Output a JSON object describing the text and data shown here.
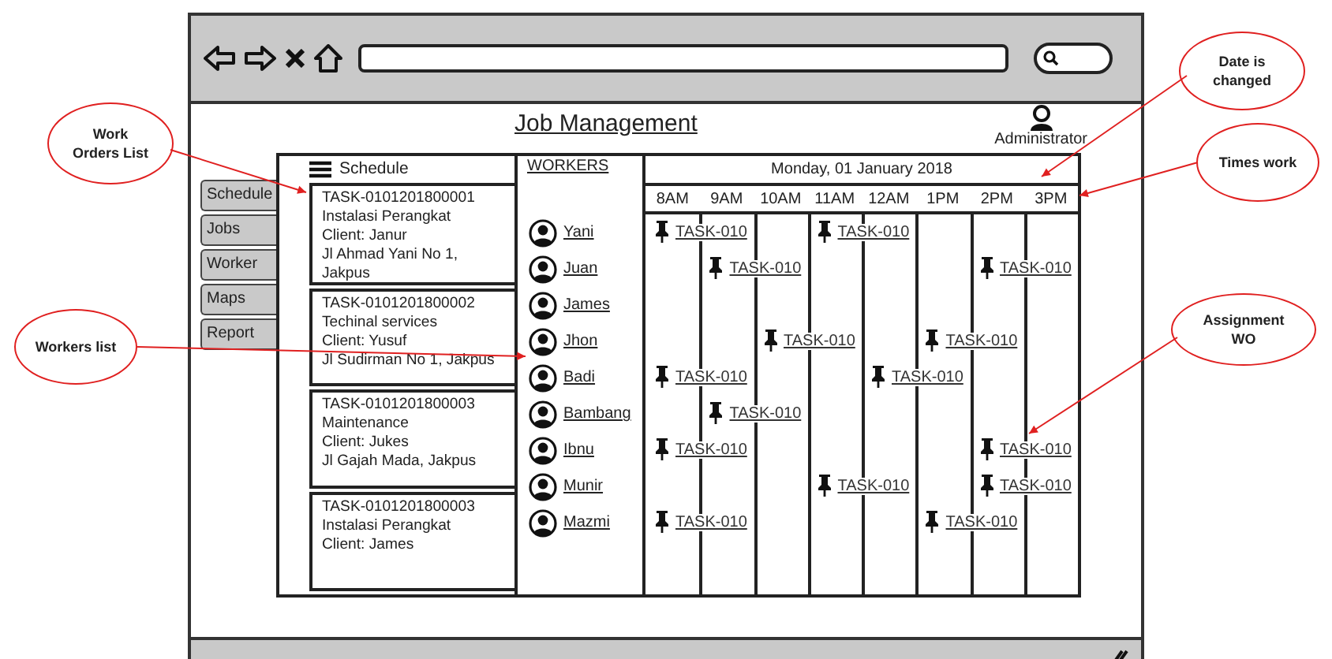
{
  "page_title": "Job Management",
  "user": {
    "name": "Administrator"
  },
  "nav_tabs": [
    {
      "label": "Schedule"
    },
    {
      "label": "Jobs"
    },
    {
      "label": "Worker"
    },
    {
      "label": "Maps"
    },
    {
      "label": "Report"
    }
  ],
  "schedule": {
    "title": "Schedule",
    "orders": [
      {
        "lines": [
          "TASK-0101201800001",
          "Instalasi Perangkat",
          "Client: Janur",
          "Jl Ahmad Yani No 1, Jakpus"
        ]
      },
      {
        "lines": [
          "TASK-0101201800002",
          "Techinal services",
          "Client: Yusuf",
          "Jl Sudirman No 1, Jakpus"
        ]
      },
      {
        "lines": [
          "TASK-0101201800003",
          "Maintenance",
          "Client: Jukes",
          "Jl Gajah Mada, Jakpus"
        ]
      },
      {
        "lines": [
          "TASK-0101201800003",
          "Instalasi Perangkat",
          "Client: James"
        ]
      }
    ]
  },
  "timeline": {
    "date": "Monday, 01 January 2018",
    "times": [
      "8AM",
      "9AM",
      "10AM",
      "11AM",
      "12AM",
      "1PM",
      "2PM",
      "3PM"
    ]
  },
  "workers": {
    "title": "WORKERS",
    "items": [
      {
        "name": "Yani",
        "slots": [
          {
            "assigned": true,
            "task": "TASK-010"
          },
          {
            "assigned": false
          },
          {
            "assigned": false
          },
          {
            "assigned": true,
            "task": "TASK-010"
          },
          {
            "assigned": false
          },
          {
            "assigned": false
          },
          {
            "assigned": false
          },
          {
            "assigned": false
          }
        ]
      },
      {
        "name": "Juan",
        "slots": [
          {
            "assigned": false
          },
          {
            "assigned": true,
            "task": "TASK-010"
          },
          {
            "assigned": false
          },
          {
            "assigned": false
          },
          {
            "assigned": false
          },
          {
            "assigned": false
          },
          {
            "assigned": true,
            "task": "TASK-010"
          },
          {
            "assigned": false
          }
        ]
      },
      {
        "name": "James",
        "slots": [
          {
            "assigned": false
          },
          {
            "assigned": false
          },
          {
            "assigned": false
          },
          {
            "assigned": false
          },
          {
            "assigned": false
          },
          {
            "assigned": false
          },
          {
            "assigned": false
          },
          {
            "assigned": false
          }
        ]
      },
      {
        "name": "Jhon",
        "slots": [
          {
            "assigned": false
          },
          {
            "assigned": false
          },
          {
            "assigned": true,
            "task": "TASK-010"
          },
          {
            "assigned": false
          },
          {
            "assigned": false
          },
          {
            "assigned": true,
            "task": "TASK-010"
          },
          {
            "assigned": false
          },
          {
            "assigned": false
          }
        ]
      },
      {
        "name": "Badi",
        "slots": [
          {
            "assigned": true,
            "task": "TASK-010"
          },
          {
            "assigned": false
          },
          {
            "assigned": false
          },
          {
            "assigned": false
          },
          {
            "assigned": true,
            "task": "TASK-010"
          },
          {
            "assigned": false
          },
          {
            "assigned": false
          },
          {
            "assigned": false
          }
        ]
      },
      {
        "name": "Bambang",
        "slots": [
          {
            "assigned": false
          },
          {
            "assigned": true,
            "task": "TASK-010"
          },
          {
            "assigned": false
          },
          {
            "assigned": false
          },
          {
            "assigned": false
          },
          {
            "assigned": false
          },
          {
            "assigned": false
          },
          {
            "assigned": false
          }
        ]
      },
      {
        "name": "Ibnu",
        "slots": [
          {
            "assigned": true,
            "task": "TASK-010"
          },
          {
            "assigned": false
          },
          {
            "assigned": false
          },
          {
            "assigned": false
          },
          {
            "assigned": false
          },
          {
            "assigned": false
          },
          {
            "assigned": true,
            "task": "TASK-010"
          },
          {
            "assigned": false
          }
        ]
      },
      {
        "name": "Munir",
        "slots": [
          {
            "assigned": false
          },
          {
            "assigned": false
          },
          {
            "assigned": false
          },
          {
            "assigned": true,
            "task": "TASK-010"
          },
          {
            "assigned": false
          },
          {
            "assigned": false
          },
          {
            "assigned": true,
            "task": "TASK-010"
          },
          {
            "assigned": false
          }
        ]
      },
      {
        "name": "Mazmi",
        "slots": [
          {
            "assigned": true,
            "task": "TASK-010"
          },
          {
            "assigned": false
          },
          {
            "assigned": false
          },
          {
            "assigned": false
          },
          {
            "assigned": false
          },
          {
            "assigned": true,
            "task": "TASK-010"
          },
          {
            "assigned": false
          },
          {
            "assigned": false
          }
        ]
      }
    ]
  },
  "annotations": [
    {
      "text": "Work Orders List"
    },
    {
      "text": "Workers list"
    },
    {
      "text": "Date is changed"
    },
    {
      "text": "Times work"
    },
    {
      "text": "Assignment WO"
    }
  ]
}
